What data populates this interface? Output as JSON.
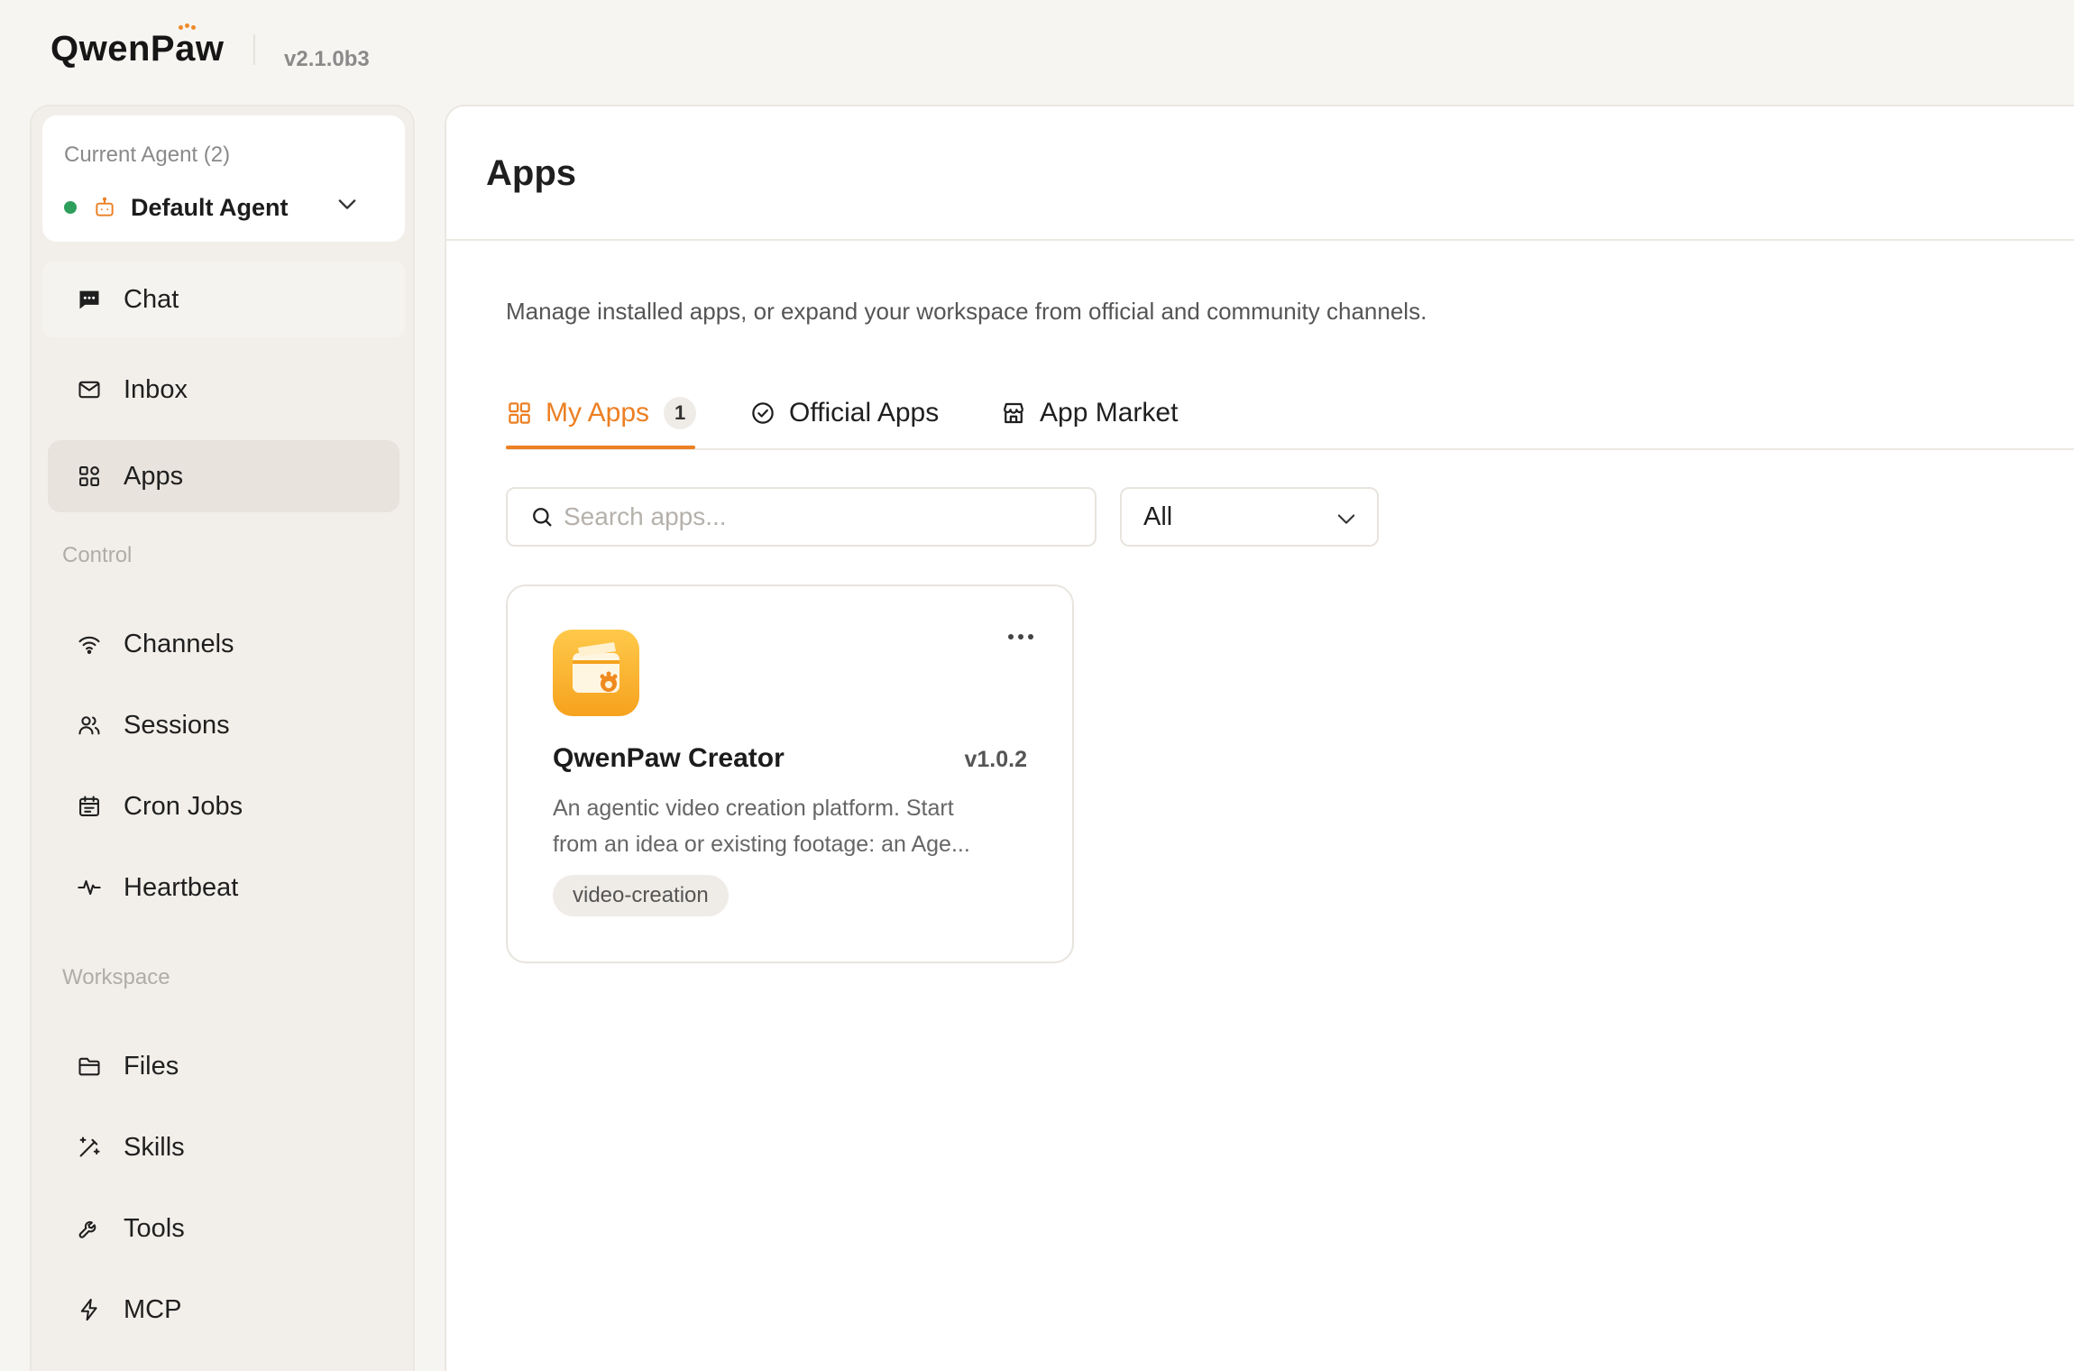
{
  "header": {
    "logo_prefix": "Qwen",
    "logo_a_prefix": "P",
    "logo_a": "a",
    "logo_suffix": "w",
    "version": "v2.1.0b3"
  },
  "agent": {
    "title": "Current Agent (2)",
    "name": "Default Agent",
    "status_color": "#2e9e5b"
  },
  "sidebar": {
    "items": [
      {
        "label": "Chat",
        "icon": "chat-icon"
      },
      {
        "label": "Inbox",
        "icon": "inbox-icon"
      },
      {
        "label": "Apps",
        "icon": "apps-icon",
        "active": true
      },
      {
        "label": "Channels",
        "icon": "wifi-icon"
      },
      {
        "label": "Sessions",
        "icon": "users-icon"
      },
      {
        "label": "Cron Jobs",
        "icon": "calendar-icon"
      },
      {
        "label": "Heartbeat",
        "icon": "pulse-icon"
      },
      {
        "label": "Files",
        "icon": "folder-icon"
      },
      {
        "label": "Skills",
        "icon": "magic-wand-icon"
      },
      {
        "label": "Tools",
        "icon": "wrench-icon"
      },
      {
        "label": "MCP",
        "icon": "lightning-icon"
      }
    ],
    "sections": {
      "control": "Control",
      "workspace": "Workspace"
    }
  },
  "main": {
    "title": "Apps",
    "description": "Manage installed apps, or expand your workspace from official and community channels.",
    "tabs": [
      {
        "label": "My Apps",
        "badge": "1",
        "icon": "grid-icon",
        "active": true
      },
      {
        "label": "Official Apps",
        "icon": "check-circle-icon"
      },
      {
        "label": "App Market",
        "icon": "store-icon"
      }
    ],
    "search": {
      "placeholder": "Search apps...",
      "value": ""
    },
    "filter": {
      "selected": "All"
    },
    "apps": [
      {
        "name": "QwenPaw Creator",
        "version": "v1.0.2",
        "description_line1": "An agentic video creation platform. Start",
        "description_line2": "from an idea or existing footage: an Age...",
        "tag": "video-creation",
        "icon": "creator-app-icon"
      }
    ]
  },
  "colors": {
    "accent": "#ec7f23",
    "background": "#f7f5f2",
    "active_nav": "#e8e3dc"
  }
}
